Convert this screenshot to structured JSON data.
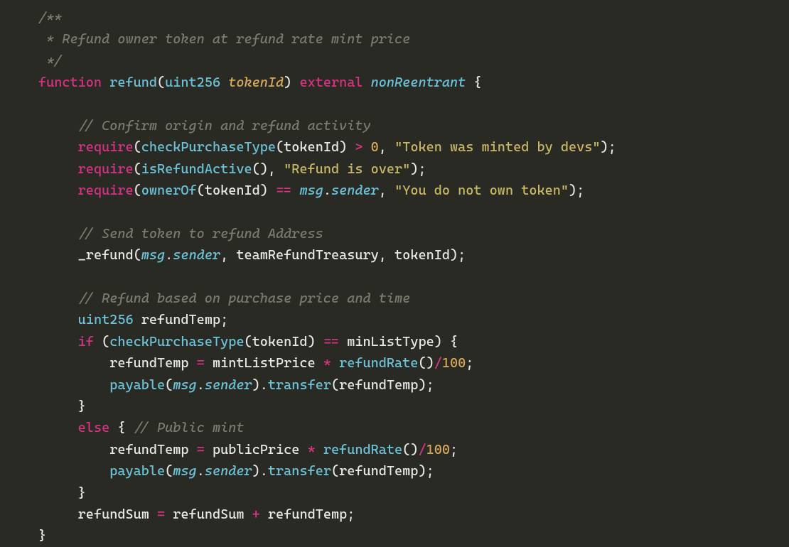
{
  "code": {
    "comment_block_1": "/**",
    "comment_block_2": " * Refund owner token at refund rate mint price",
    "comment_block_3": " */",
    "kw_function": "function",
    "fn_refund": "refund",
    "type_uint256": "uint256",
    "param_tokenId": "tokenId",
    "mod_external": "external",
    "mod_nonReentrant": "nonReentrant",
    "comment_confirm": "// Confirm origin and refund activity",
    "kw_require": "require",
    "fn_checkPurchaseType": "checkPurchaseType",
    "var_tokenId": "tokenId",
    "num_0": "0",
    "str_minted_devs": "\"Token was minted by devs\"",
    "fn_isRefundActive": "isRefundActive",
    "str_refund_over": "\"Refund is over\"",
    "fn_ownerOf": "ownerOf",
    "kw_msg": "msg",
    "kw_sender": "sender",
    "str_not_own": "\"You do not own token\"",
    "comment_send": "// Send token to refund Address",
    "fn_refund_internal": "_refund",
    "var_teamRefundTreasury": "teamRefundTreasury",
    "comment_refund_based": "// Refund based on purchase price and time",
    "var_refundTemp": "refundTemp",
    "kw_if": "if",
    "var_minListType": "minListType",
    "var_mintListPrice": "mintListPrice",
    "fn_refundRate": "refundRate",
    "num_100": "100",
    "kw_payable": "payable",
    "fn_transfer": "transfer",
    "kw_else": "else",
    "comment_public": "// Public mint",
    "var_publicPrice": "publicPrice",
    "var_refundSum": "refundSum"
  }
}
